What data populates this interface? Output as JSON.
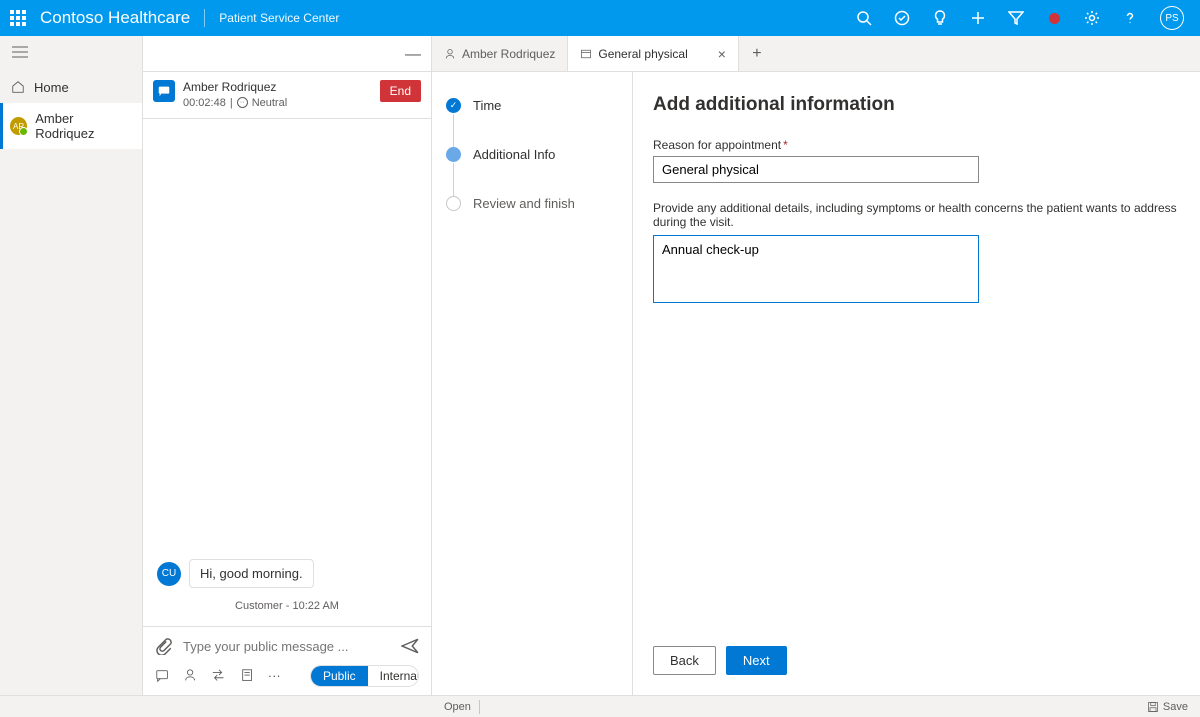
{
  "header": {
    "brand": "Contoso Healthcare",
    "subtitle": "Patient Service Center",
    "avatar_initials": "PS"
  },
  "leftnav": {
    "home": "Home",
    "patient": "Amber Rodriquez",
    "patient_initials": "AR"
  },
  "chat": {
    "session_name": "Amber Rodriquez",
    "duration": "00:02:48",
    "sentiment": "Neutral",
    "end_label": "End",
    "message_text": "Hi, good morning.",
    "message_sender_initials": "CU",
    "message_meta": "Customer - 10:22 AM",
    "input_placeholder": "Type your public message ...",
    "pill_public": "Public",
    "pill_internal": "Internal"
  },
  "tabs": {
    "tab1": "Amber Rodriquez",
    "tab2": "General physical"
  },
  "stepper": {
    "s1": "Time",
    "s2": "Additional Info",
    "s3": "Review and finish"
  },
  "form": {
    "title": "Add additional information",
    "reason_label": "Reason for appointment",
    "reason_value": "General physical",
    "details_label": "Provide any additional details, including symptoms or health concerns the patient wants to address during the visit.",
    "details_value": "Annual check-up",
    "back": "Back",
    "next": "Next"
  },
  "statusbar": {
    "open": "Open",
    "save": "Save"
  }
}
